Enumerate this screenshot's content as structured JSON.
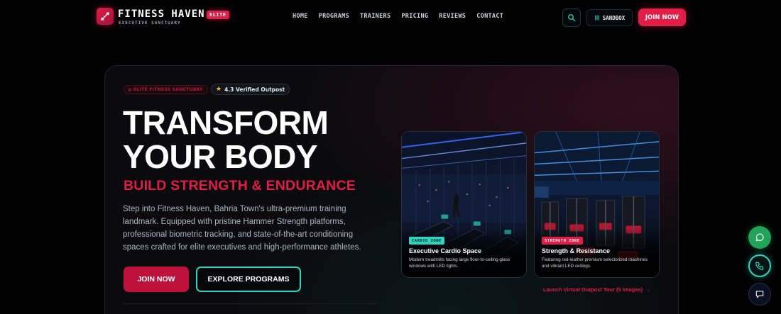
{
  "header": {
    "brand_name": "FITNESS HAVEN",
    "brand_badge": "ELITE",
    "brand_tagline": "EXECUTIVE SANCTUARY",
    "nav": [
      {
        "label": "HOME"
      },
      {
        "label": "PROGRAMS"
      },
      {
        "label": "TRAINERS"
      },
      {
        "label": "PRICING"
      },
      {
        "label": "REVIEWS"
      },
      {
        "label": "CONTACT"
      }
    ],
    "search_icon": "search-icon",
    "sandbox_label": "SANDBOX",
    "join_label": "JOIN NOW"
  },
  "hero": {
    "pill_elite": "ELITE FITNESS SANCTUARY",
    "rating_label": "4.3 Verified Outpost",
    "headline_line1": "TRANSFORM",
    "headline_line2": "YOUR BODY",
    "subheadline": "BUILD STRENGTH & ENDURANCE",
    "description": "Step into Fitness Haven, Bahria Town's ultra-premium training landmark. Equipped with pristine Hammer Strength platforms, professional biometric tracking, and state-of-the-art conditioning spaces crafted for elite executives and high-performance athletes.",
    "join_button": "JOIN NOW",
    "explore_button": "EXPLORE PROGRAMS",
    "cards": [
      {
        "tag": "CARDIO ZONE",
        "title": "Executive Cardio Space",
        "description": "Modern treadmills facing large floor-to-ceiling glass windows with LED lights."
      },
      {
        "tag": "STRENGTH ZONE",
        "title": "Strength & Resistance",
        "description": "Featuring red-leather premium selectorized machines and vibrant LED ceilings."
      }
    ],
    "tour_link": "Launch Virtual Outpost Tour (5 Images)"
  },
  "colors": {
    "accent": "#e11d48",
    "teal": "#2dd4bf",
    "background": "#000000",
    "whatsapp": "#22a35a"
  },
  "floating": {
    "whatsapp_icon": "whatsapp-icon",
    "phone_icon": "phone-icon",
    "chat_icon": "chat-icon"
  }
}
